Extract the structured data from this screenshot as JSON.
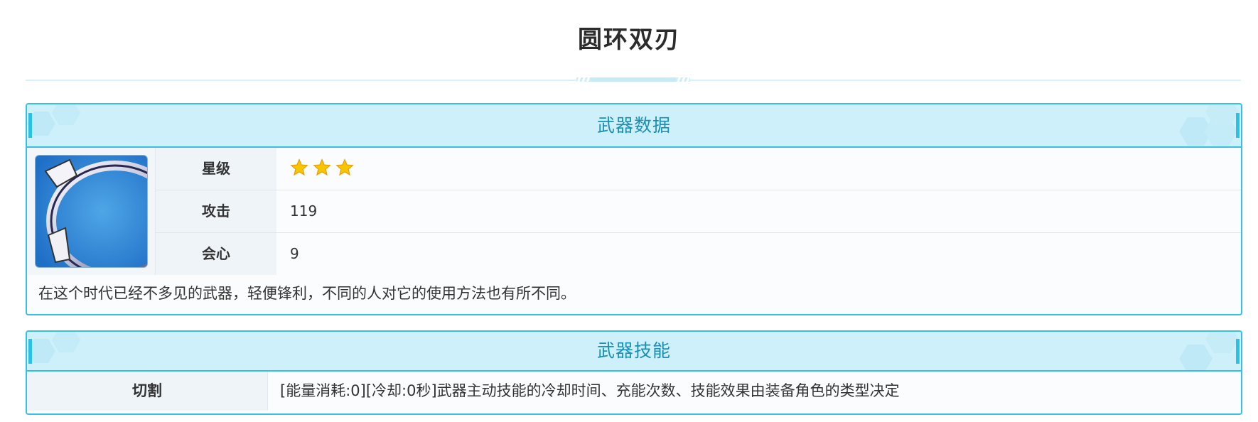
{
  "page": {
    "title": "圆环双刃"
  },
  "weapon_data": {
    "header": "武器数据",
    "image_alt": "weapon-ring-blades-image",
    "stats": [
      {
        "label": "星级",
        "value": "",
        "stars": 3
      },
      {
        "label": "攻击",
        "value": "119"
      },
      {
        "label": "会心",
        "value": "9"
      }
    ],
    "description": "在这个时代已经不多见的武器，轻便锋利，不同的人对它的使用方法也有所不同。"
  },
  "weapon_skill": {
    "header": "武器技能",
    "skill_name": "切割",
    "skill_desc": "[能量消耗:0][冷却:0秒]武器主动技能的冷却时间、充能次数、技能效果由装备角色的类型决定"
  },
  "colors": {
    "accent": "#35c1e3",
    "header_bg": "#cdf0fb",
    "header_text": "#1b8fb4",
    "star": "#f7c600"
  }
}
